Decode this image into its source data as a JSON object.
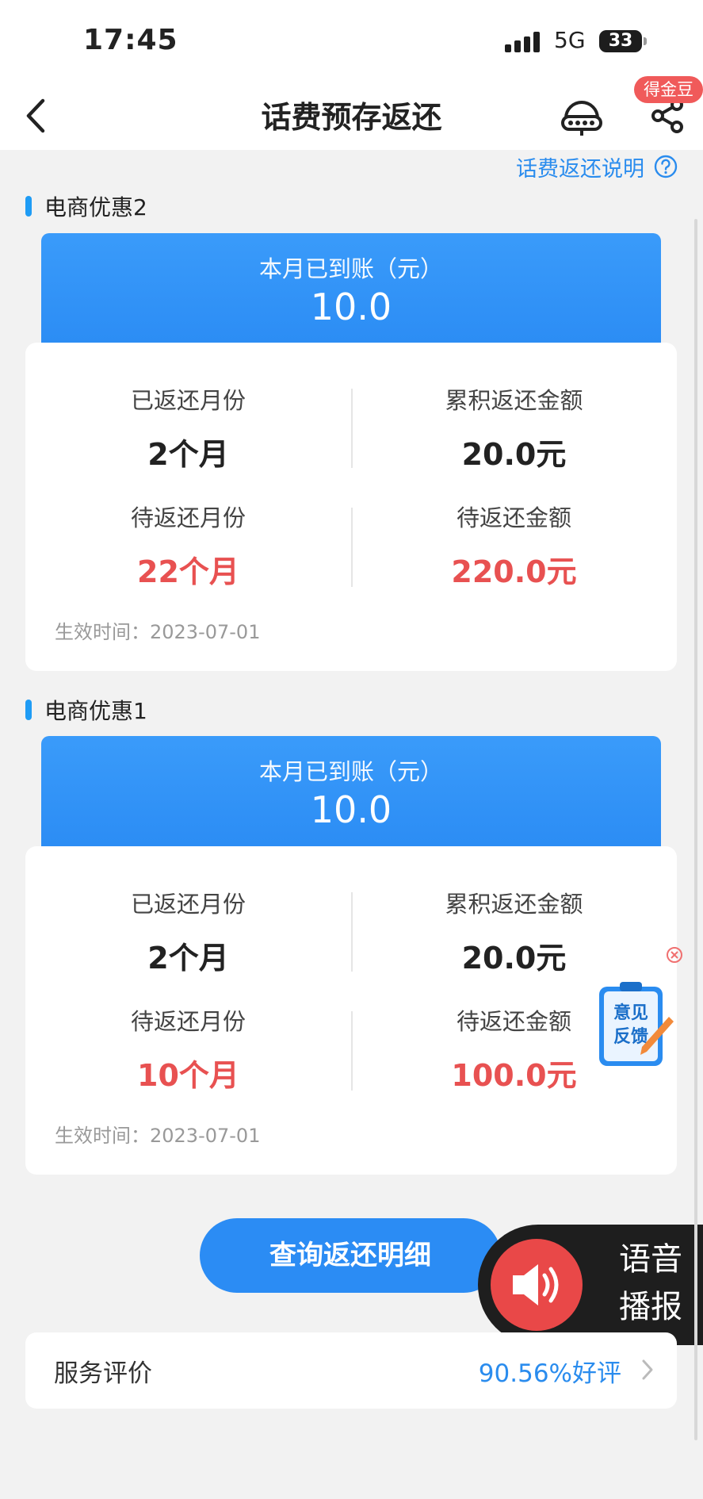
{
  "status_bar": {
    "time": "17:45",
    "network": "5G",
    "battery": "33"
  },
  "nav": {
    "title": "话费预存返还",
    "badge": "得金豆",
    "cs_icon": "customer-service-icon",
    "share_icon": "share-icon"
  },
  "helper_link": {
    "label": "话费返还说明"
  },
  "sections": [
    {
      "title": "电商优惠2",
      "received_label": "本月已到账（元）",
      "received_value": "10.0",
      "returned_months_label": "已返还月份",
      "returned_months": "2个月",
      "total_returned_label": "累积返还金额",
      "total_returned": "20.0元",
      "pending_months_label": "待返还月份",
      "pending_months": "22个月",
      "pending_amount_label": "待返还金额",
      "pending_amount": "220.0元",
      "effective": "生效时间：2023-07-01"
    },
    {
      "title": "电商优惠1",
      "received_label": "本月已到账（元）",
      "received_value": "10.0",
      "returned_months_label": "已返还月份",
      "returned_months": "2个月",
      "total_returned_label": "累积返还金额",
      "total_returned": "20.0元",
      "pending_months_label": "待返还月份",
      "pending_months": "10个月",
      "pending_amount_label": "待返还金额",
      "pending_amount": "100.0元",
      "effective": "生效时间：2023-07-01"
    }
  ],
  "feedback": {
    "line1": "意见",
    "line2": "反馈"
  },
  "query_button": {
    "label": "查询返还明细"
  },
  "voice": {
    "line1": "语音",
    "line2": "播报"
  },
  "rating": {
    "label": "服务评价",
    "value": "90.56%好评"
  },
  "colors": {
    "accent": "#2b8cf4",
    "red": "#e85151",
    "link": "#2a8cee"
  }
}
